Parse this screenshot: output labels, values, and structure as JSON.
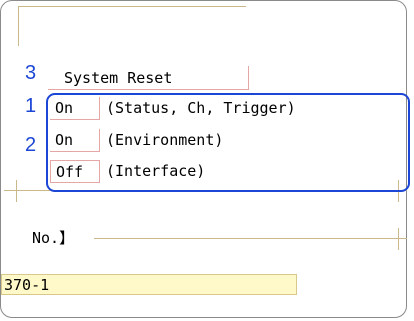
{
  "callouts": [
    "3",
    "1",
    "2"
  ],
  "system_reset": {
    "label": "System Reset"
  },
  "settings": [
    {
      "value": "On",
      "description": "(Status, Ch, Trigger)"
    },
    {
      "value": "On",
      "description": "(Environment)"
    },
    {
      "value": "Off",
      "description": "(Interface)"
    }
  ],
  "number_section": {
    "label": "No.】",
    "value": "370-1"
  },
  "colors": {
    "callout_blue": "#1c46d6",
    "field_bg": "#fff8c8",
    "cell_border": "#e7a6a6",
    "guide_line": "#c9b98a"
  }
}
